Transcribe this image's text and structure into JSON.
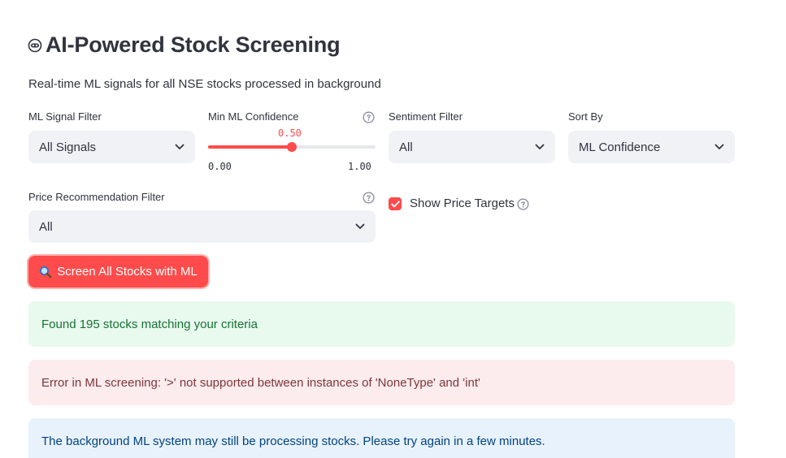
{
  "header": {
    "title": "AI-Powered Stock Screening",
    "title_icon": "robot-icon",
    "subtitle": "Real-time ML signals for all NSE stocks processed in background"
  },
  "filters": {
    "ml_signal": {
      "label": "ML Signal Filter",
      "value": "All Signals"
    },
    "min_confidence": {
      "label": "Min ML Confidence",
      "value": "0.50",
      "min": "0.00",
      "max": "1.00",
      "fraction": 0.5
    },
    "sentiment": {
      "label": "Sentiment Filter",
      "value": "All"
    },
    "sort_by": {
      "label": "Sort By",
      "value": "ML Confidence"
    },
    "price_rec": {
      "label": "Price Recommendation Filter",
      "value": "All"
    },
    "show_price_targets": {
      "label": "Show Price Targets",
      "checked": true
    }
  },
  "actions": {
    "screen_button": {
      "label": "Screen All Stocks with ML",
      "icon": "magnifier-icon"
    }
  },
  "alerts": {
    "success": "Found 195 stocks matching your criteria",
    "error": "Error in ML screening: '>' not supported between instances of 'NoneType' and 'int'",
    "info": "The background ML system may still be processing stocks. Please try again in a few minutes."
  },
  "colors": {
    "accent": "#ff4b4b",
    "select_bg": "#f0f2f6",
    "success_bg": "#e8f9ee",
    "success_text": "#177233",
    "error_bg": "#fdeced",
    "error_text": "#7d353b",
    "info_bg": "#e8f2fd",
    "info_text": "#004280"
  }
}
